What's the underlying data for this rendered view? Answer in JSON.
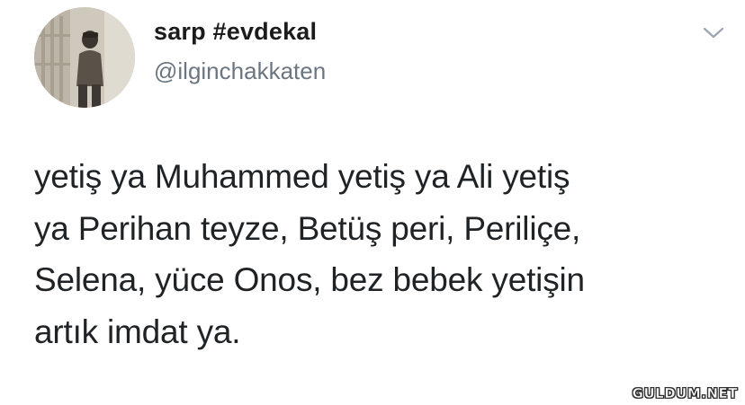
{
  "tweet": {
    "author": {
      "display_name": "sarp #evdekal",
      "handle": "@ilginchakkaten",
      "avatar_icon": "user-photo-avatar"
    },
    "menu_icon": "chevron-down-icon",
    "text_lines": [
      "yetiş ya Muhammed yetiş ya Ali yetiş",
      "ya Perihan teyze, Betüş peri, Periliçe,",
      "Selena, yüce Onos, bez bebek yetişin",
      "artık imdat ya."
    ]
  },
  "watermark": {
    "text": "GULDUM.NET"
  },
  "colors": {
    "background": "#ffffff",
    "text": "#1f2326",
    "secondary_text": "#6b7681",
    "chevron": "#9aa5b1"
  }
}
